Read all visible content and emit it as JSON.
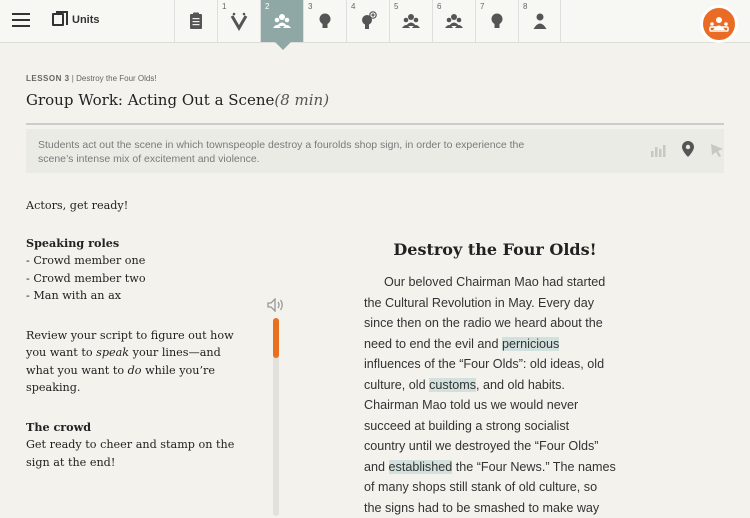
{
  "header": {
    "units_label": "Units",
    "tabs": [
      {
        "num": "",
        "icon": "clipboard-icon"
      },
      {
        "num": "1",
        "icon": "vocab-v-icon"
      },
      {
        "num": "2",
        "icon": "group-icon"
      },
      {
        "num": "3",
        "icon": "lightbulb-icon"
      },
      {
        "num": "4",
        "icon": "lightbulb-plus-icon"
      },
      {
        "num": "5",
        "icon": "group-icon"
      },
      {
        "num": "6",
        "icon": "group-icon"
      },
      {
        "num": "7",
        "icon": "lightbulb-icon"
      },
      {
        "num": "8",
        "icon": "person-icon"
      }
    ],
    "active_tab": 2,
    "accent_color": "#ea6b24",
    "active_tab_color": "#8fa8a5"
  },
  "lesson": {
    "label": "LESSON 3",
    "separator": " | ",
    "name": "Destroy the Four Olds!",
    "activity_title": "Group Work: Acting Out a Scene",
    "duration": "(8 min)",
    "summary": "Students act out the scene in which townspeople destroy a fourolds shop sign, in order to experience the scene’s intense mix of excitement and violence."
  },
  "instructions": {
    "intro": "Actors, get ready!",
    "speaking_heading": "Speaking roles",
    "roles": [
      "- Crowd member one",
      "- Crowd member two",
      "- Man with an ax"
    ],
    "review_1": "Review your script to figure out how",
    "review_2a": "you want to ",
    "review_2b": "speak",
    "review_2c": " your lines—and",
    "review_3a": "what you want to ",
    "review_3b": "do",
    "review_3c": " while you’re",
    "review_4": "speaking.",
    "crowd_heading": "The crowd",
    "crowd_1": "Get ready to cheer and stamp on the",
    "crowd_2": "sign at the end!"
  },
  "story": {
    "title": "Destroy the Four Olds!",
    "l1": "Our beloved Chairman Mao had started",
    "l2": "the Cultural Revolution in May. Every day",
    "l3": "since then on the radio we heard about the",
    "l4a": "need to end the evil and ",
    "l4b": "pernicious",
    "l5": "influences of the “Four Olds”: old ideas, old",
    "l6a": "culture, old ",
    "l6b": "customs",
    "l6c": ", and old habits.",
    "l7": "Chairman Mao told us we would never",
    "l8": "succeed at building a strong socialist",
    "l9": "country until we destroyed the “Four Olds”",
    "l10a": "and ",
    "l10b": "established",
    "l10c": " the “Four News.” The names",
    "l11": "of many shops still stank of old culture, so",
    "l12": "the signs had to be smashed to make way"
  }
}
